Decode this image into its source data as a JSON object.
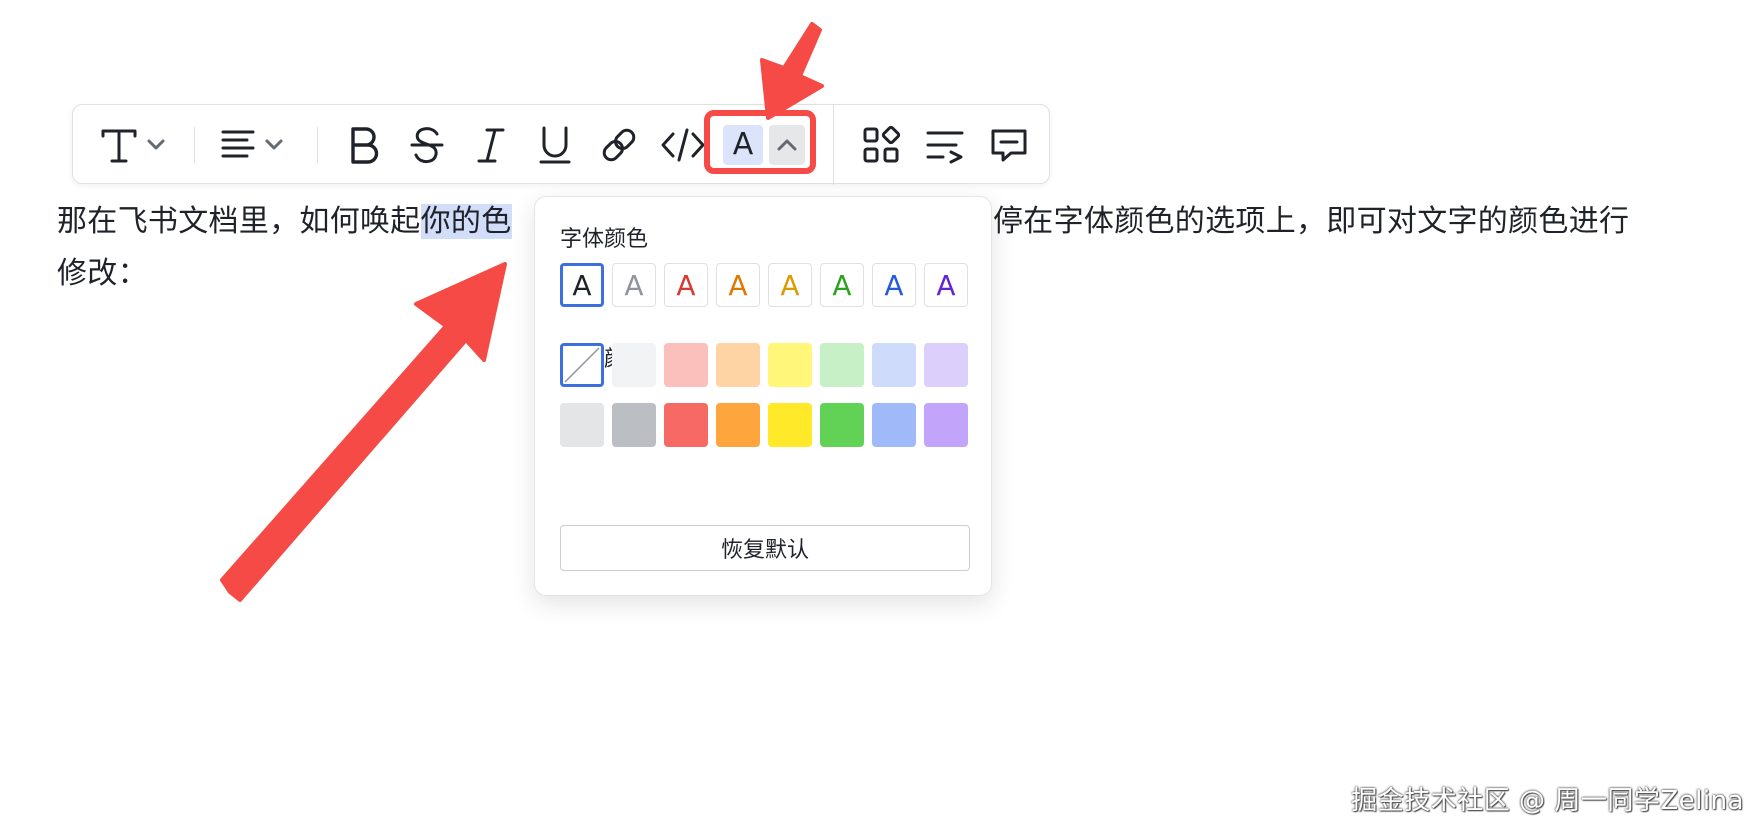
{
  "toolbar": {
    "items": [
      "text-style",
      "align",
      "bold",
      "strikethrough",
      "italic",
      "underline",
      "link",
      "code",
      "font-color",
      "more-blocks",
      "text-direction",
      "comment"
    ],
    "font_color_glyph": "A",
    "highlight_color": "#f54a45"
  },
  "paragraph": {
    "line1_before": "那在飞书文档里，如何唤起",
    "line1_selected": "你的色",
    "line1_after": "停在字体颜色的选项上，即可对文字的颜色进行",
    "line2": "修改："
  },
  "color_popup": {
    "font_color_label": "字体颜色",
    "background_color_label": "背景颜色",
    "font_colors": [
      {
        "glyph": "A",
        "color": "#1f2329"
      },
      {
        "glyph": "A",
        "color": "#8f959e"
      },
      {
        "glyph": "A",
        "color": "#d83931"
      },
      {
        "glyph": "A",
        "color": "#de7802"
      },
      {
        "glyph": "A",
        "color": "#dc9b04"
      },
      {
        "glyph": "A",
        "color": "#2ea121"
      },
      {
        "glyph": "A",
        "color": "#245bdb"
      },
      {
        "glyph": "A",
        "color": "#6425d0"
      }
    ],
    "background_colors_light": [
      "none",
      "#f2f3f5",
      "#fbbfbc",
      "#fed4a4",
      "#fff67a",
      "#c8f0c6",
      "#cfdbfb",
      "#dccffb"
    ],
    "background_colors_strong": [
      "#e4e5e7",
      "#bbbfc4",
      "#f76964",
      "#ffa53d",
      "#ffe928",
      "#62d256",
      "#a0b9f9",
      "#c2a4fa"
    ],
    "reset_label": "恢复默认"
  },
  "watermark": "掘金技术社区 @ 周一同学Zelina",
  "annotation_color": "#f54a45"
}
